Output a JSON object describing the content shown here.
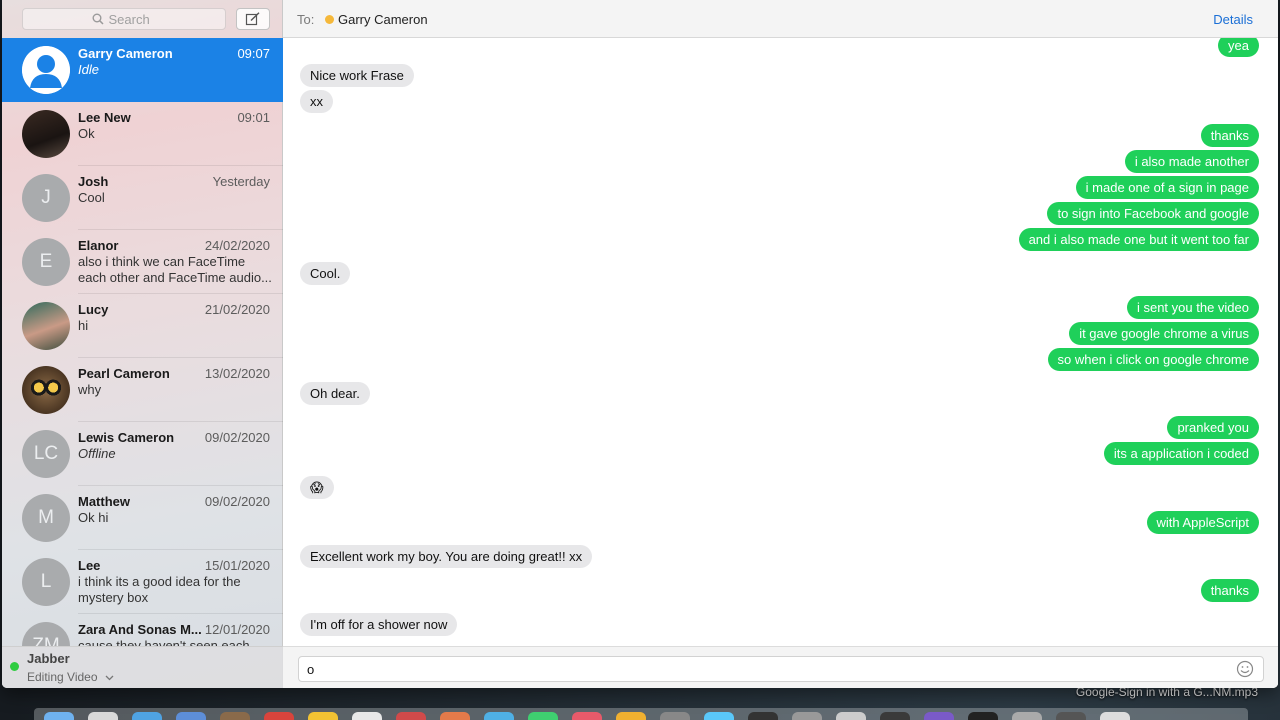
{
  "sidebar": {
    "search_placeholder": "Search",
    "conversations": [
      {
        "name": "Garry Cameron",
        "date": "09:07",
        "preview": "Idle",
        "italic": true,
        "avatar": "person-silhouette",
        "initials": "",
        "selected": true
      },
      {
        "name": "Lee New",
        "date": "09:01",
        "preview": "Ok",
        "italic": false,
        "avatar": "photo",
        "initials": "",
        "selected": false
      },
      {
        "name": "Josh",
        "date": "Yesterday",
        "preview": "Cool",
        "italic": false,
        "avatar": "initials",
        "initials": "J",
        "selected": false
      },
      {
        "name": "Elanor",
        "date": "24/02/2020",
        "preview": "also i think we can FaceTime each other and FaceTime audio...",
        "italic": false,
        "avatar": "initials",
        "initials": "E",
        "selected": false
      },
      {
        "name": "Lucy",
        "date": "21/02/2020",
        "preview": "hi",
        "italic": false,
        "avatar": "photo",
        "initials": "",
        "selected": false
      },
      {
        "name": "Pearl Cameron",
        "date": "13/02/2020",
        "preview": "why",
        "italic": false,
        "avatar": "owl-photo",
        "initials": "",
        "selected": false
      },
      {
        "name": "Lewis Cameron",
        "date": "09/02/2020",
        "preview": "Offline",
        "italic": true,
        "avatar": "initials",
        "initials": "LC",
        "selected": false
      },
      {
        "name": "Matthew",
        "date": "09/02/2020",
        "preview": "Ok hi",
        "italic": false,
        "avatar": "initials",
        "initials": "M",
        "selected": false
      },
      {
        "name": "Lee",
        "date": "15/01/2020",
        "preview": "i think its a good idea for the mystery box",
        "italic": false,
        "avatar": "initials",
        "initials": "L",
        "selected": false
      },
      {
        "name": "Zara And Sonas M...",
        "date": "12/01/2020",
        "preview": "cause they haven't seen each",
        "italic": false,
        "avatar": "initials",
        "initials": "ZM",
        "selected": false
      }
    ],
    "account": {
      "name": "Jabber",
      "status": "Editing Video",
      "status_color": "#2ecc40"
    }
  },
  "chat": {
    "to_label": "To:",
    "recipient": "Garry Cameron",
    "recipient_status_color": "#f5b83a",
    "details_label": "Details",
    "messages": [
      {
        "dir": "out",
        "text": "yea"
      },
      {
        "dir": "in",
        "text": "Nice work Frase"
      },
      {
        "dir": "in",
        "text": "xx"
      },
      {
        "dir": "out",
        "text": "thanks"
      },
      {
        "dir": "out",
        "text": "i also made another"
      },
      {
        "dir": "out",
        "text": "i made one of a sign in page"
      },
      {
        "dir": "out",
        "text": "to sign into Facebook and google"
      },
      {
        "dir": "out",
        "text": "and i also made one but it went too far"
      },
      {
        "dir": "in",
        "text": "Cool."
      },
      {
        "dir": "out",
        "text": "i sent you the video"
      },
      {
        "dir": "out",
        "text": "it gave google chrome a virus"
      },
      {
        "dir": "out",
        "text": "so when i click on google chrome"
      },
      {
        "dir": "in",
        "text": "Oh dear."
      },
      {
        "dir": "out",
        "text": "pranked you"
      },
      {
        "dir": "out",
        "text": "its a application i coded"
      },
      {
        "dir": "in",
        "text": "😱"
      },
      {
        "dir": "out",
        "text": "with AppleScript"
      },
      {
        "dir": "in",
        "text": "Excellent work my boy. You are doing great!! xx"
      },
      {
        "dir": "out",
        "text": "thanks"
      },
      {
        "dir": "in",
        "text": "I'm off for a shower now"
      }
    ],
    "composer_value": "o",
    "incoming_color": "#e7e7e9",
    "outgoing_color": "#1fd05a"
  },
  "desktop": {
    "file_label": "Google-Sign in with a G...NM.mp3"
  }
}
